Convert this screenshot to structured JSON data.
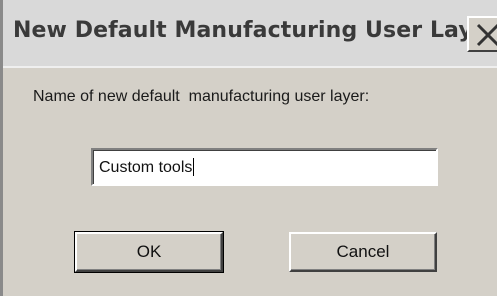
{
  "dialog": {
    "title": "New Default Manufacturing User Layer",
    "close_icon": "close-icon",
    "prompt": "Name of new default  manufacturing user layer:",
    "name_field": {
      "value": "Custom tools"
    },
    "buttons": {
      "ok_label": "OK",
      "cancel_label": "Cancel"
    }
  }
}
